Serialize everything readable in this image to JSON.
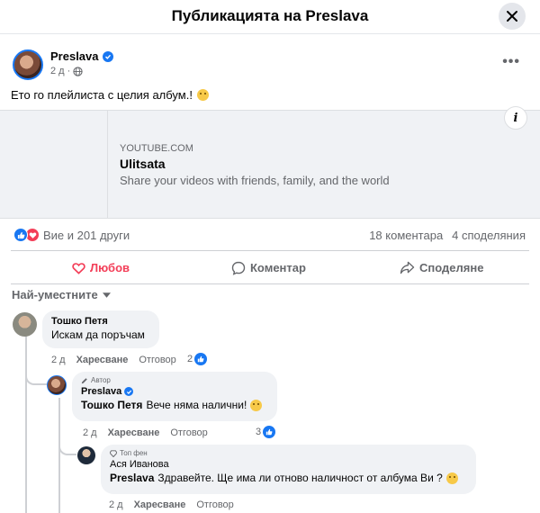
{
  "header": {
    "title": "Публикацията на Preslava"
  },
  "post": {
    "author": "Preslava",
    "time": "2 д",
    "text": "Ето го плейлиста с целия албум.!",
    "link": {
      "domain": "YOUTUBE.COM",
      "title": "Ulitsata",
      "description": "Share your videos with friends, family, and the world"
    },
    "reactions_text": "Вие и 201 други",
    "comments_count": "18 коментара",
    "shares_count": "4 споделяния"
  },
  "actions": {
    "love": "Любов",
    "comment": "Коментар",
    "share": "Споделяне"
  },
  "sort_label": "Най-уместните",
  "comments": [
    {
      "name": "Тошко Петя",
      "text": "Искам да поръчам",
      "time": "2 д",
      "like": "Харесване",
      "reply": "Отговор",
      "likes": "2"
    },
    {
      "badge": "Автор",
      "name": "Preslava",
      "mention": "Тошко Петя",
      "text": "Вече няма налични!",
      "time": "2 д",
      "like": "Харесване",
      "reply": "Отговор",
      "likes": "3"
    },
    {
      "badge": "Топ фен",
      "name": "Ася Иванова",
      "mention": "Preslava",
      "text": "Здравейте. Ще има ли отново наличност от албума Ви ?",
      "time": "2 д",
      "like": "Харесване",
      "reply": "Отговор"
    }
  ],
  "icons": {
    "close": "close-icon",
    "verified": "verified-icon",
    "globe": "globe-icon",
    "more": "more-horizontal-icon",
    "info": "info-icon",
    "like": "like-icon",
    "love": "love-icon",
    "comment": "comment-icon",
    "share": "share-icon",
    "chevron": "chevron-down-icon",
    "author_badge": "pencil-icon",
    "top_fan_badge": "diamond-icon"
  },
  "colors": {
    "accent": "#1877f2",
    "love": "#f33e58",
    "secondary_text": "#65676b",
    "bubble": "#f0f2f5"
  }
}
